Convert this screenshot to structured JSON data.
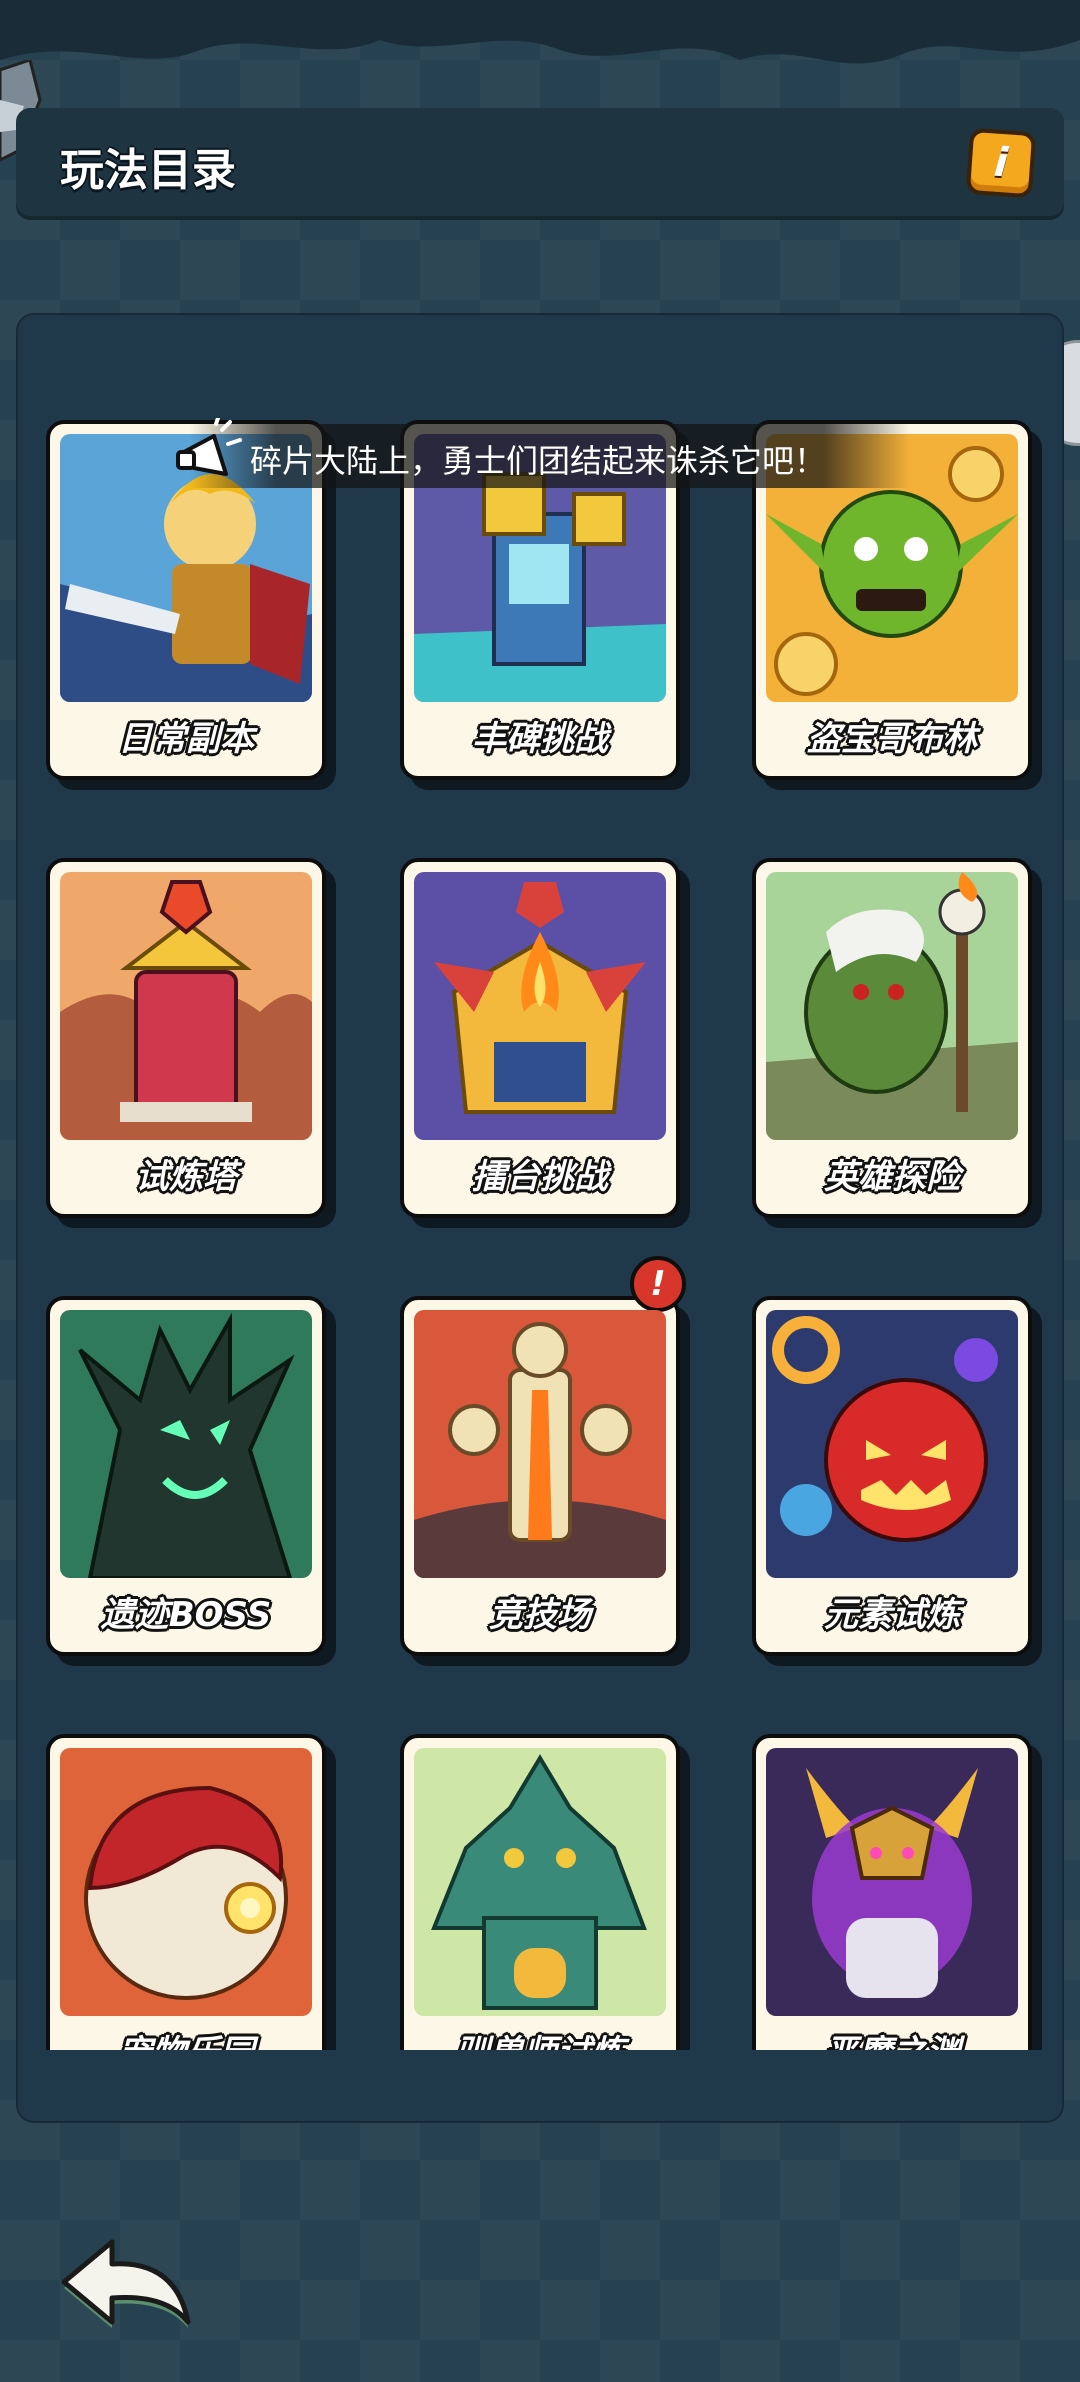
{
  "header": {
    "title": "玩法目录"
  },
  "info_button": {
    "icon": "info-icon",
    "glyph": "i"
  },
  "marquee": {
    "text": "碎片大陆上，勇士们团结起来诛杀它吧！"
  },
  "cards": [
    {
      "label": "日常副本",
      "icon": "hero-swordsman-icon",
      "badge": false
    },
    {
      "label": "丰碑挑战",
      "icon": "tower-monument-icon",
      "badge": false
    },
    {
      "label": "盗宝哥布林",
      "icon": "goblin-thief-icon",
      "badge": false
    },
    {
      "label": "试炼塔",
      "icon": "red-tower-icon",
      "badge": false
    },
    {
      "label": "擂台挑战",
      "icon": "fire-arena-icon",
      "badge": false
    },
    {
      "label": "英雄探险",
      "icon": "orc-shaman-icon",
      "badge": false
    },
    {
      "label": "遗迹BOSS",
      "icon": "tree-monster-icon",
      "badge": false
    },
    {
      "label": "竞技场",
      "icon": "lava-altar-icon",
      "badge": true
    },
    {
      "label": "元素试炼",
      "icon": "pumpkin-demon-icon",
      "badge": false
    },
    {
      "label": "宠物乐园",
      "icon": "pet-egg-icon",
      "badge": false
    },
    {
      "label": "驯兽师试炼",
      "icon": "beast-tower-icon",
      "badge": false
    },
    {
      "label": "恶魔之渊",
      "icon": "demon-lord-icon",
      "badge": false
    }
  ],
  "badge_glyph": "!",
  "footer": {
    "back_icon": "back-arrow-icon"
  },
  "colors": {
    "background": "#26414f",
    "panel": "#20394a",
    "card": "#fcf7e6",
    "accent_orange": "#f3a81d",
    "alert_red": "#d9362b"
  }
}
